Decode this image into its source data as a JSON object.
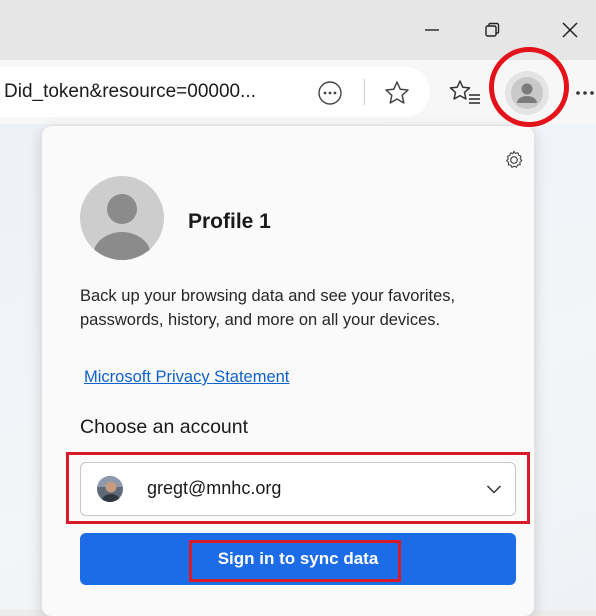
{
  "window": {
    "controls": [
      "minimize-icon",
      "restore-icon",
      "close-icon"
    ]
  },
  "toolbar": {
    "url_fragment": "Did_token&resource=00000...",
    "icons": [
      "more-tools-icon",
      "favorite-star-icon",
      "favorites-list-icon",
      "profile-icon",
      "settings-more-icon"
    ]
  },
  "profile_panel": {
    "profile_name": "Profile 1",
    "description": "Back up your browsing data and see your favorites, passwords, history, and more on all your devices.",
    "privacy_link": "Microsoft Privacy Statement",
    "choose_account_label": "Choose an account",
    "selected_account": "gregt@mnhc.org",
    "sign_in_button": "Sign in to sync data"
  },
  "colors": {
    "accent": "#1b6ce6",
    "link": "#0f62c9",
    "annotation": "#e3121b"
  }
}
